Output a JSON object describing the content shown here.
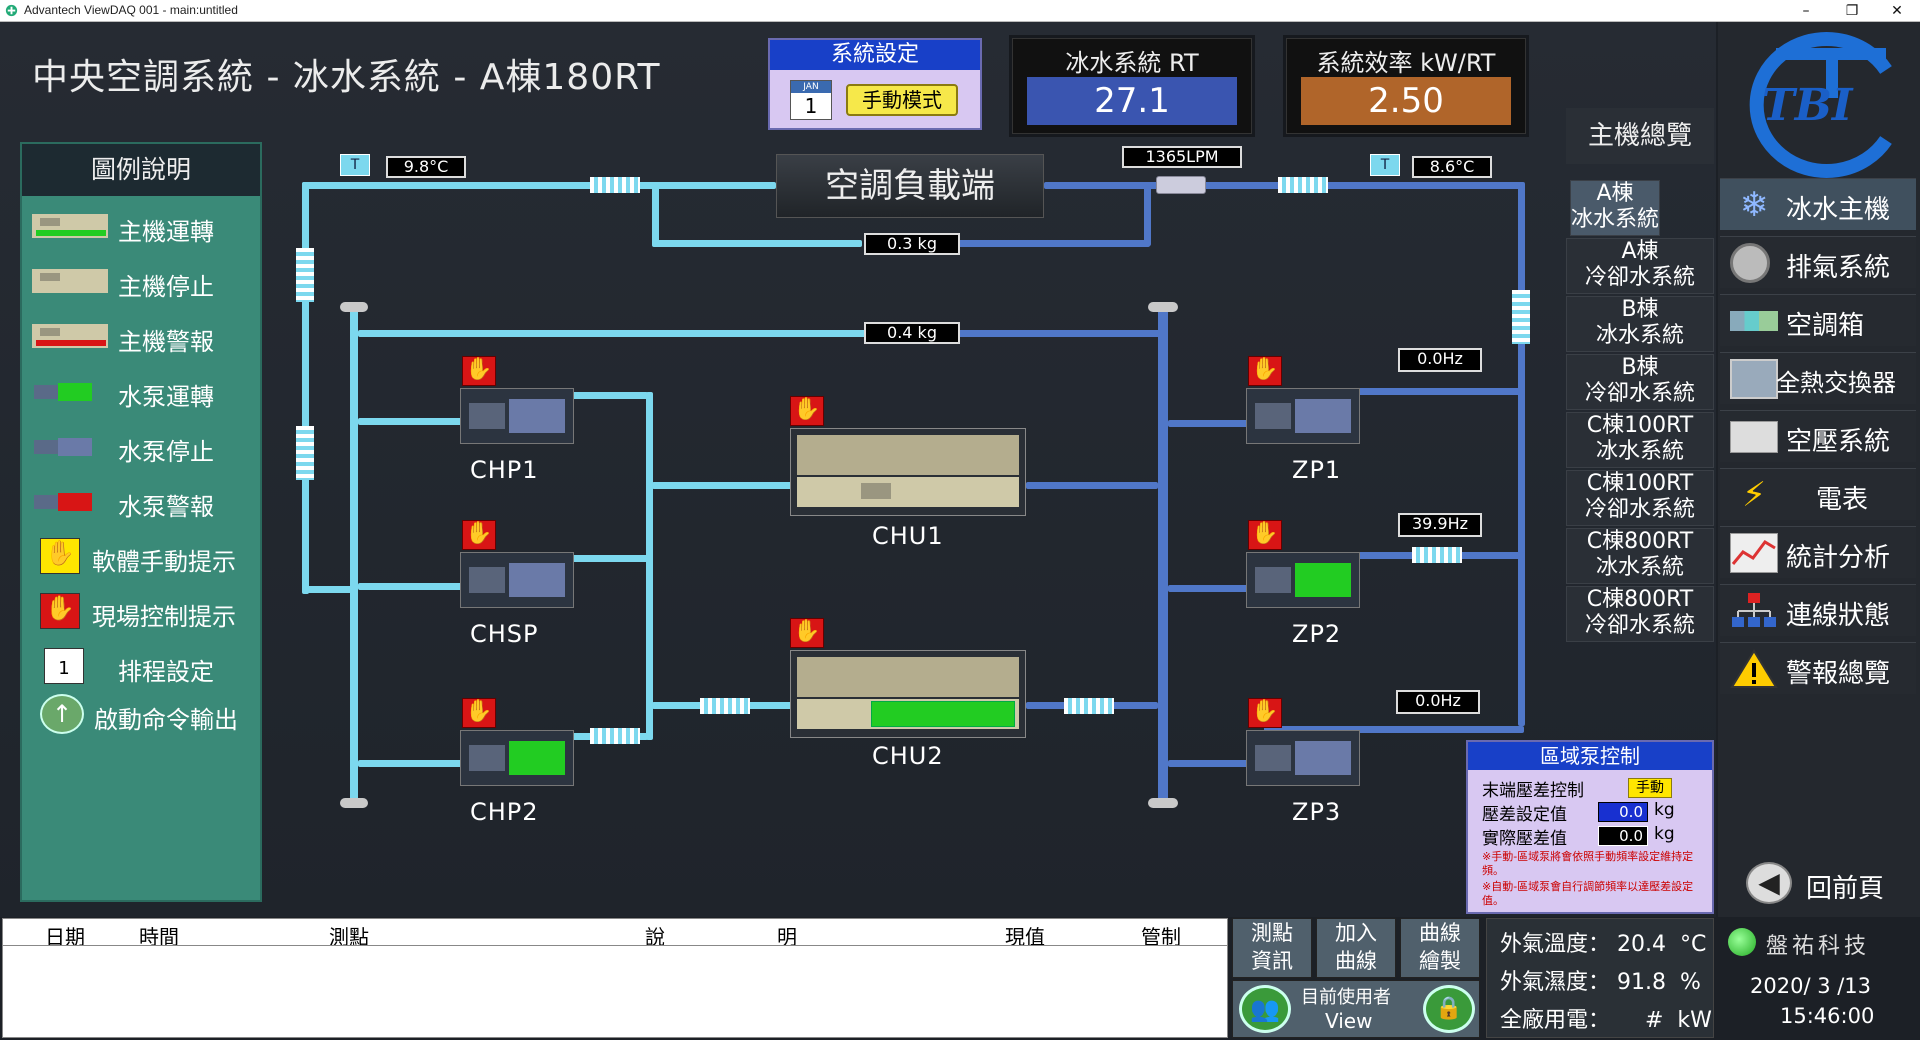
{
  "window": {
    "title": "Advantech ViewDAQ 001 - main:untitled",
    "minimize": "–",
    "maximize": "❐",
    "close": "✕"
  },
  "page_title": "中央空調系統 - 冰水系統 - A棟180RT",
  "system_setting": {
    "label": "系統設定",
    "mode": "手動模式",
    "calendar_month": "JAN",
    "calendar_day": "1"
  },
  "chilled_rt": {
    "label": "冰水系統 RT",
    "value": "27.1"
  },
  "efficiency": {
    "label": "系統效率 kW/RT",
    "value": "2.50"
  },
  "load_end": "空調負載端",
  "legend": {
    "title": "圖例說明",
    "items": [
      {
        "label": "主機運轉",
        "icon": "chiller-running-icon"
      },
      {
        "label": "主機停止",
        "icon": "chiller-stopped-icon"
      },
      {
        "label": "主機警報",
        "icon": "chiller-alarm-icon"
      },
      {
        "label": "水泵運轉",
        "icon": "pump-running-icon"
      },
      {
        "label": "水泵停止",
        "icon": "pump-stopped-icon"
      },
      {
        "label": "水泵警報",
        "icon": "pump-alarm-icon"
      },
      {
        "label": "軟體手動提示",
        "icon": "software-manual-hand-icon"
      },
      {
        "label": "現場控制提示",
        "icon": "local-control-hand-icon"
      },
      {
        "label": "排程設定",
        "icon": "schedule-calendar-icon"
      },
      {
        "label": "啟動命令輸出",
        "icon": "start-command-arrow-icon"
      }
    ]
  },
  "sensors": {
    "supply_temp": "9.8°C",
    "return_temp": "8.6°C",
    "flow": "1365LPM",
    "bypass_pressure": "0.3 kg",
    "header_pressure": "0.4 kg",
    "zp1_hz": "0.0Hz",
    "zp2_hz": "39.9Hz",
    "zp3_hz": "0.0Hz",
    "temp_tag": "T"
  },
  "equipment": {
    "chp1": "CHP1",
    "chsp": "CHSP",
    "chp2": "CHP2",
    "chu1": "CHU1",
    "chu2": "CHU2",
    "zp1": "ZP1",
    "zp2": "ZP2",
    "zp3": "ZP3"
  },
  "zone_pump_control": {
    "title": "區域泵控制",
    "terminal_dp_label": "末端壓差控制",
    "terminal_dp_mode": "手動",
    "dp_setpoint_label": "壓差設定值",
    "dp_setpoint": "0.0",
    "dp_actual_label": "實際壓差值",
    "dp_actual": "0.0",
    "unit": "kg",
    "note1": "※手動-區域泵將會依照手動頻率設定維持定頻。",
    "note2": "※自動-區域泵會自行調節頻率以達壓差設定值。"
  },
  "nav": {
    "overview": "主機總覽",
    "items": [
      {
        "line1": "A棟",
        "line2": "冰水系統"
      },
      {
        "line1": "A棟",
        "line2": "冷卻水系統"
      },
      {
        "line1": "B棟",
        "line2": "冰水系統"
      },
      {
        "line1": "B棟",
        "line2": "冷卻水系統"
      },
      {
        "line1": "C棟100RT",
        "line2": "冰水系統"
      },
      {
        "line1": "C棟100RT",
        "line2": "冷卻水系統"
      },
      {
        "line1": "C棟800RT",
        "line2": "冰水系統"
      },
      {
        "line1": "C棟800RT",
        "line2": "冷卻水系統"
      }
    ]
  },
  "logo": {
    "text": "TBI"
  },
  "systems": [
    {
      "label": "冰水主機",
      "icon": "snowflake-icon"
    },
    {
      "label": "排氣系統",
      "icon": "exhaust-fan-icon"
    },
    {
      "label": "空調箱",
      "icon": "ahu-icon"
    },
    {
      "label": "全熱交換器",
      "icon": "heat-exchanger-icon"
    },
    {
      "label": "空壓系統",
      "icon": "air-compressor-icon"
    },
    {
      "label": "電表",
      "icon": "lightning-icon"
    },
    {
      "label": "統計分析",
      "icon": "chart-icon"
    },
    {
      "label": "連線狀態",
      "icon": "network-icon"
    },
    {
      "label": "警報總覽",
      "icon": "warning-icon"
    }
  ],
  "back": "回前頁",
  "table": {
    "headers": [
      "日期",
      "時間",
      "測點",
      "說",
      "明",
      "現值",
      "管制"
    ]
  },
  "bottom_buttons": {
    "point_info": [
      "測點",
      "資訊"
    ],
    "add_curve": [
      "加入",
      "曲線"
    ],
    "draw_curve": [
      "曲線",
      "繪製"
    ],
    "current_user_label": "目前使用者",
    "current_user": "View"
  },
  "environment": {
    "outdoor_temp_label": "外氣溫度：",
    "outdoor_temp": "20.4",
    "outdoor_temp_unit": "°C",
    "outdoor_hum_label": "外氣濕度：",
    "outdoor_hum": "91.8",
    "outdoor_hum_unit": "%",
    "power_label": "全廠用電：",
    "power": "#",
    "power_unit": "kW"
  },
  "company": "盤祐科技",
  "datetime": {
    "date": "2020/ 3 /13",
    "time": "15:46:00"
  },
  "colors": {
    "light_pipe": "#7cd8ee",
    "dark_pipe": "#5077c8",
    "legend_bg": "#3a8a78",
    "rt_box": "#3a55b0",
    "eff_box": "#b0652a",
    "alarm_red": "#d81515",
    "run_green": "#22cc22"
  }
}
